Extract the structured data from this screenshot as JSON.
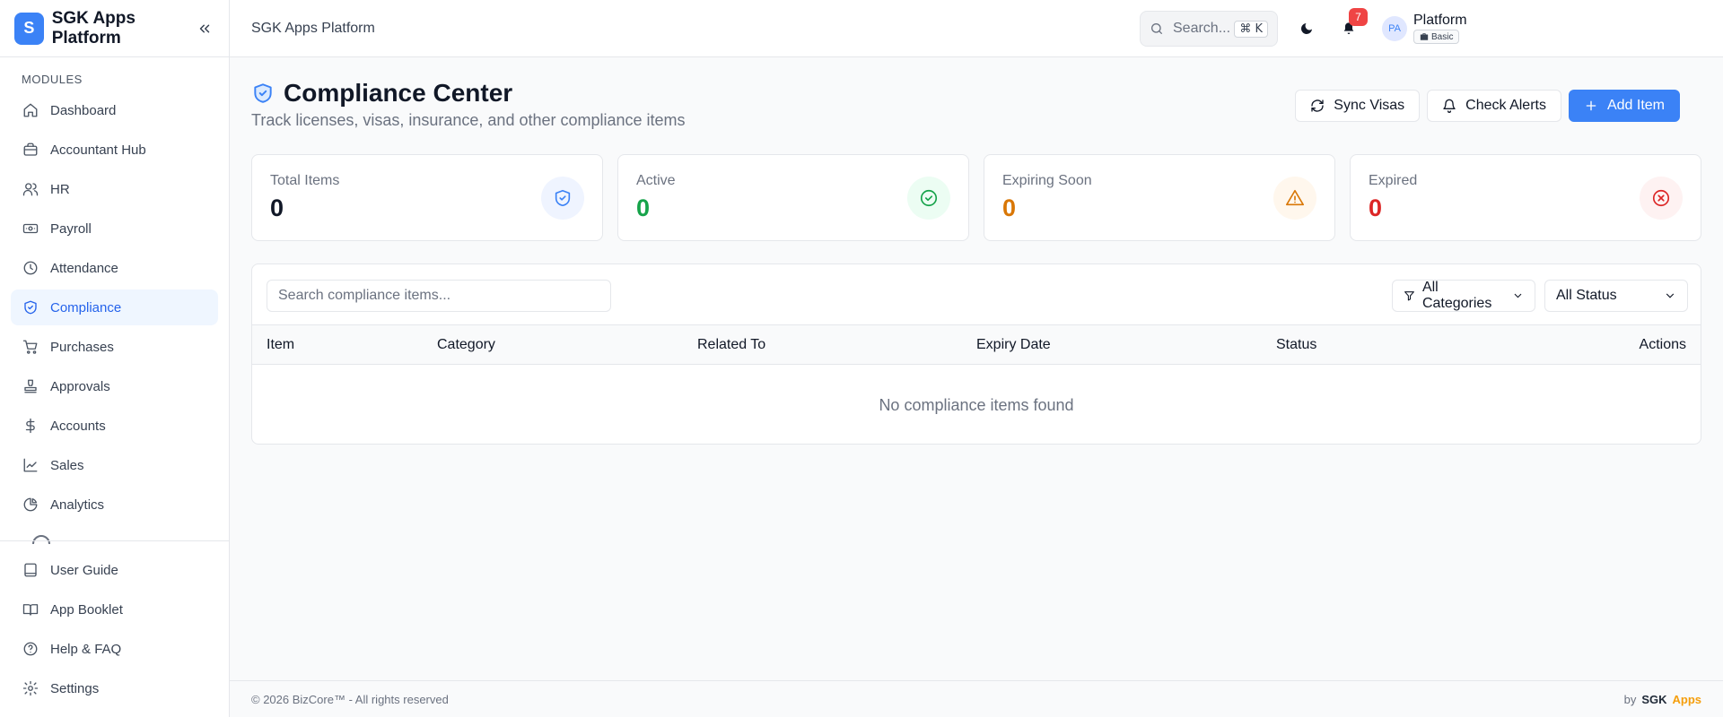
{
  "brand": {
    "logo_letter": "S",
    "name": "SGK Apps Platform"
  },
  "sidebar": {
    "section_label": "MODULES",
    "items": [
      {
        "label": "Dashboard",
        "icon": "home-icon"
      },
      {
        "label": "Accountant Hub",
        "icon": "briefcase-icon"
      },
      {
        "label": "HR",
        "icon": "users-icon"
      },
      {
        "label": "Payroll",
        "icon": "banknote-icon"
      },
      {
        "label": "Attendance",
        "icon": "clock-icon"
      },
      {
        "label": "Compliance",
        "icon": "shield-check-icon",
        "active": true
      },
      {
        "label": "Purchases",
        "icon": "shopping-cart-icon"
      },
      {
        "label": "Approvals",
        "icon": "stamp-icon"
      },
      {
        "label": "Accounts",
        "icon": "dollar-icon"
      },
      {
        "label": "Sales",
        "icon": "trending-up-icon"
      },
      {
        "label": "Analytics",
        "icon": "pie-chart-icon"
      }
    ],
    "bottom_items": [
      {
        "label": "User Guide",
        "icon": "book-icon"
      },
      {
        "label": "App Booklet",
        "icon": "book-open-icon"
      },
      {
        "label": "Help & FAQ",
        "icon": "help-circle-icon"
      },
      {
        "label": "Settings",
        "icon": "gear-icon"
      }
    ]
  },
  "header": {
    "title": "SGK Apps Platform",
    "search_label": "Search...",
    "shortcut": "⌘ K",
    "notification_count": "7",
    "avatar_initials": "PA",
    "user_name": "Platform",
    "plan": "Basic"
  },
  "page": {
    "title": "Compliance Center",
    "subtitle": "Track licenses, visas, insurance, and other compliance items",
    "actions": {
      "sync": "Sync Visas",
      "alerts": "Check Alerts",
      "add": "Add Item"
    }
  },
  "stats": [
    {
      "label": "Total Items",
      "value": "0",
      "color": "#111827",
      "icon": "shield-check-icon",
      "bg": "#eff4ff",
      "fg": "#3b82f6"
    },
    {
      "label": "Active",
      "value": "0",
      "color": "#16a34a",
      "icon": "check-circle-icon",
      "bg": "#ecfdf3",
      "fg": "#16a34a"
    },
    {
      "label": "Expiring Soon",
      "value": "0",
      "color": "#d97706",
      "icon": "alert-triangle-icon",
      "bg": "#fff7ed",
      "fg": "#d97706"
    },
    {
      "label": "Expired",
      "value": "0",
      "color": "#dc2626",
      "icon": "x-circle-icon",
      "bg": "#fef2f2",
      "fg": "#dc2626"
    }
  ],
  "table": {
    "search_placeholder": "Search compliance items...",
    "category_filter": "All Categories",
    "status_filter": "All Status",
    "columns": [
      "Item",
      "Category",
      "Related To",
      "Expiry Date",
      "Status",
      "Actions"
    ],
    "empty_text": "No compliance items found"
  },
  "footer": {
    "copyright": "© 2026 BizCore™ - All rights reserved",
    "by": "by",
    "sgk": "SGK",
    "apps": "Apps"
  }
}
